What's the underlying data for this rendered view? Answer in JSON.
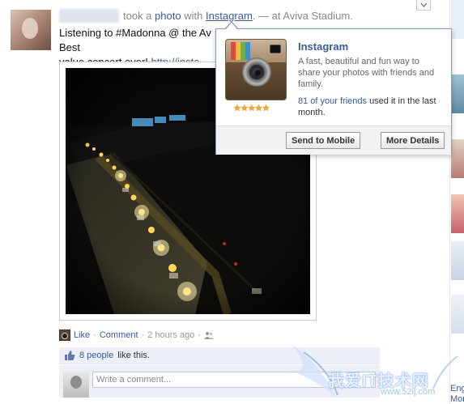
{
  "story": {
    "took_text": "took a",
    "photo_link": "photo",
    "with_text": "with",
    "app_link": "Instagram",
    "location_text": ". — at Aviva Stadium."
  },
  "message": {
    "line1_start": "Listening to #Madonna @ the Av",
    "line1_end": "s / Best",
    "line2_start": "value concert ever!",
    "line2_link": "http://insta"
  },
  "actions": {
    "like": "Like",
    "comment": "Comment",
    "separator": "·",
    "timestamp": "2 hours ago"
  },
  "likes": {
    "count_link": "8 people",
    "suffix": "like this."
  },
  "comment_input": {
    "placeholder": "Write a comment..."
  },
  "hover_card": {
    "title": "Instagram",
    "description": "A fast, beautiful and fun way to share your photos with friends and family.",
    "friends_link": "81 of your friends",
    "friends_suffix": "used it in the last month.",
    "rating_stars": "★★★★★",
    "rating_value": 4.5,
    "send_button": "Send to Mobile",
    "details_button": "More Details"
  },
  "right_rail": {
    "text1": "Eng",
    "text2": "Mor"
  },
  "watermark": {
    "text": "我爱IT技术网",
    "url": "www.52ij.com"
  },
  "colors": {
    "link": "#3b5998",
    "feedback_bg": "#eceff5",
    "card_border": "#8b9dc3",
    "star": "#f6a623"
  }
}
